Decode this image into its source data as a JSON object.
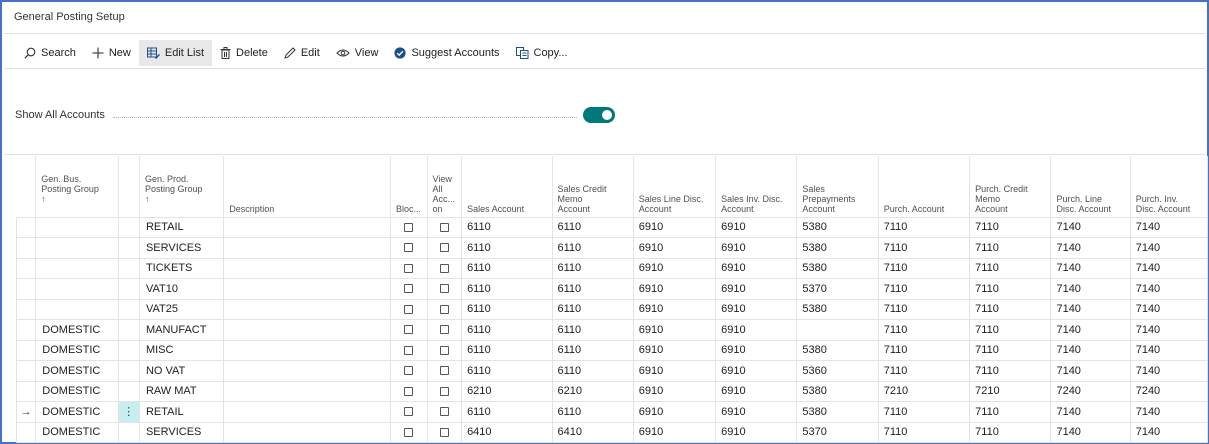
{
  "page": {
    "title": "General Posting Setup"
  },
  "toolbar": {
    "search": "Search",
    "new": "New",
    "edit_list": "Edit List",
    "delete": "Delete",
    "edit": "Edit",
    "view": "View",
    "suggest_accounts": "Suggest Accounts",
    "copy": "Copy..."
  },
  "filter": {
    "show_all_accounts_label": "Show All Accounts",
    "show_all_accounts_on": true
  },
  "columns": {
    "gen_bus": [
      "Gen. Bus.",
      "Posting Group",
      "↑"
    ],
    "gen_prod": [
      "Gen. Prod.",
      "Posting Group",
      "↑"
    ],
    "description": "Description",
    "blocked": "Bloc...",
    "view_all": [
      "View",
      "All",
      "Acc...",
      "on"
    ],
    "sales_account": "Sales Account",
    "sales_credit_memo": [
      "Sales Credit",
      "Memo",
      "Account"
    ],
    "sales_line_disc": [
      "Sales Line Disc.",
      "Account"
    ],
    "sales_inv_disc": [
      "Sales Inv. Disc.",
      "Account"
    ],
    "sales_prepayments": [
      "Sales",
      "Prepayments",
      "Account"
    ],
    "purch_account": "Purch. Account",
    "purch_credit_memo": [
      "Purch. Credit",
      "Memo",
      "Account"
    ],
    "purch_line_disc": [
      "Purch. Line",
      "Disc. Account"
    ],
    "purch_inv_disc": [
      "Purch. Inv.",
      "Disc. Account"
    ]
  },
  "rows": [
    {
      "bus": "",
      "prod": "RETAIL",
      "desc": "",
      "blocked": false,
      "view_all": false,
      "sales": "6110",
      "scm": "6110",
      "sld": "6910",
      "sid": "6910",
      "spre": "5380",
      "purch": "7110",
      "pcm": "7110",
      "pld": "7140",
      "pid": "7140",
      "marker": "",
      "selected": false
    },
    {
      "bus": "",
      "prod": "SERVICES",
      "desc": "",
      "blocked": false,
      "view_all": false,
      "sales": "6110",
      "scm": "6110",
      "sld": "6910",
      "sid": "6910",
      "spre": "5380",
      "purch": "7110",
      "pcm": "7110",
      "pld": "7140",
      "pid": "7140",
      "marker": "",
      "selected": false
    },
    {
      "bus": "",
      "prod": "TICKETS",
      "desc": "",
      "blocked": false,
      "view_all": false,
      "sales": "6110",
      "scm": "6110",
      "sld": "6910",
      "sid": "6910",
      "spre": "5380",
      "purch": "7110",
      "pcm": "7110",
      "pld": "7140",
      "pid": "7140",
      "marker": "",
      "selected": false
    },
    {
      "bus": "",
      "prod": "VAT10",
      "desc": "",
      "blocked": false,
      "view_all": false,
      "sales": "6110",
      "scm": "6110",
      "sld": "6910",
      "sid": "6910",
      "spre": "5370",
      "purch": "7110",
      "pcm": "7110",
      "pld": "7140",
      "pid": "7140",
      "marker": "",
      "selected": false
    },
    {
      "bus": "",
      "prod": "VAT25",
      "desc": "",
      "blocked": false,
      "view_all": false,
      "sales": "6110",
      "scm": "6110",
      "sld": "6910",
      "sid": "6910",
      "spre": "5380",
      "purch": "7110",
      "pcm": "7110",
      "pld": "7140",
      "pid": "7140",
      "marker": "",
      "selected": false
    },
    {
      "bus": "DOMESTIC",
      "prod": "MANUFACT",
      "desc": "",
      "blocked": false,
      "view_all": false,
      "sales": "6110",
      "scm": "6110",
      "sld": "6910",
      "sid": "6910",
      "spre": "",
      "purch": "7110",
      "pcm": "7110",
      "pld": "7140",
      "pid": "7140",
      "marker": "",
      "selected": false
    },
    {
      "bus": "DOMESTIC",
      "prod": "MISC",
      "desc": "",
      "blocked": false,
      "view_all": false,
      "sales": "6110",
      "scm": "6110",
      "sld": "6910",
      "sid": "6910",
      "spre": "5380",
      "purch": "7110",
      "pcm": "7110",
      "pld": "7140",
      "pid": "7140",
      "marker": "",
      "selected": false
    },
    {
      "bus": "DOMESTIC",
      "prod": "NO VAT",
      "desc": "",
      "blocked": false,
      "view_all": false,
      "sales": "6110",
      "scm": "6110",
      "sld": "6910",
      "sid": "6910",
      "spre": "5360",
      "purch": "7110",
      "pcm": "7110",
      "pld": "7140",
      "pid": "7140",
      "marker": "",
      "selected": false
    },
    {
      "bus": "DOMESTIC",
      "prod": "RAW MAT",
      "desc": "",
      "blocked": false,
      "view_all": false,
      "sales": "6210",
      "scm": "6210",
      "sld": "6910",
      "sid": "6910",
      "spre": "5380",
      "purch": "7210",
      "pcm": "7210",
      "pld": "7240",
      "pid": "7240",
      "marker": "",
      "selected": false
    },
    {
      "bus": "DOMESTIC",
      "prod": "RETAIL",
      "desc": "",
      "blocked": false,
      "view_all": false,
      "sales": "6110",
      "scm": "6110",
      "sld": "6910",
      "sid": "6910",
      "spre": "5380",
      "purch": "7110",
      "pcm": "7110",
      "pld": "7140",
      "pid": "7140",
      "marker": "→",
      "selected": true
    },
    {
      "bus": "DOMESTIC",
      "prod": "SERVICES",
      "desc": "",
      "blocked": false,
      "view_all": false,
      "sales": "6410",
      "scm": "6410",
      "sld": "6910",
      "sid": "6910",
      "spre": "5370",
      "purch": "7110",
      "pcm": "7110",
      "pld": "7140",
      "pid": "7140",
      "marker": "",
      "selected": false
    }
  ],
  "colors": {
    "accent": "#00797a",
    "frame": "#4472c4",
    "selection": "#c6eef0"
  }
}
